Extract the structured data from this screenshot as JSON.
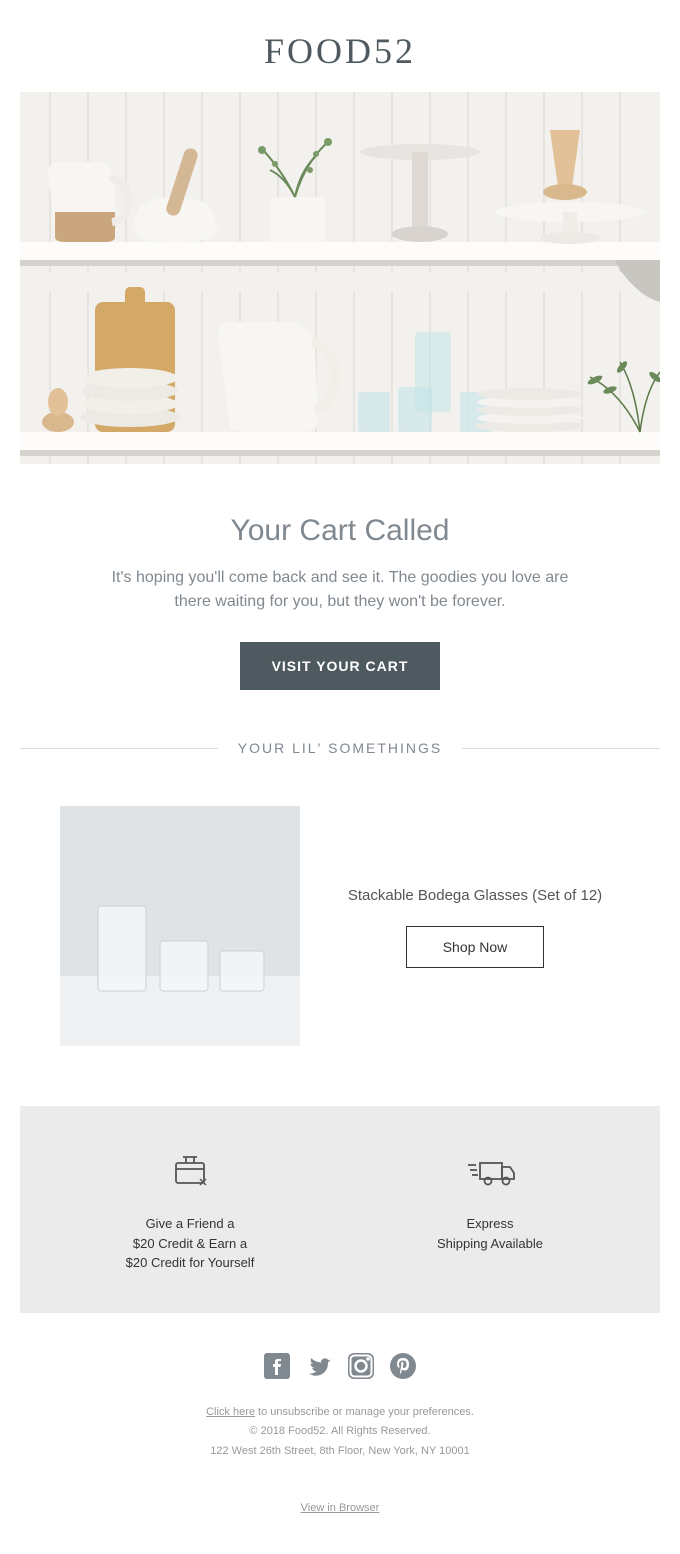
{
  "header": {
    "logo": "FOOD52"
  },
  "hero": {
    "headline": "Your Cart Called",
    "subtext": "It's hoping you'll come back and see it. The goodies you love are there waiting for you, but they won't be forever.",
    "cta_label": "VISIT YOUR CART"
  },
  "divider": {
    "label": "YOUR LIL' SOMETHINGS"
  },
  "product": {
    "name": "Stackable Bodega Glasses (Set of 12)",
    "button_label": "Shop Now"
  },
  "benefits": {
    "referral": {
      "line1": "Give a Friend a",
      "line2": "$20 Credit & Earn a",
      "line3": "$20 Credit for Yourself"
    },
    "shipping": {
      "line1": "Express",
      "line2": "Shipping Available"
    }
  },
  "footer": {
    "unsubscribe_link": "Click here",
    "unsubscribe_text": " to unsubscribe or manage your preferences.",
    "copyright": "© 2018 Food52. All Rights Reserved.",
    "address": "122 West 26th Street, 8th Floor, New York, NY 10001",
    "view_browser": "View in Browser"
  }
}
